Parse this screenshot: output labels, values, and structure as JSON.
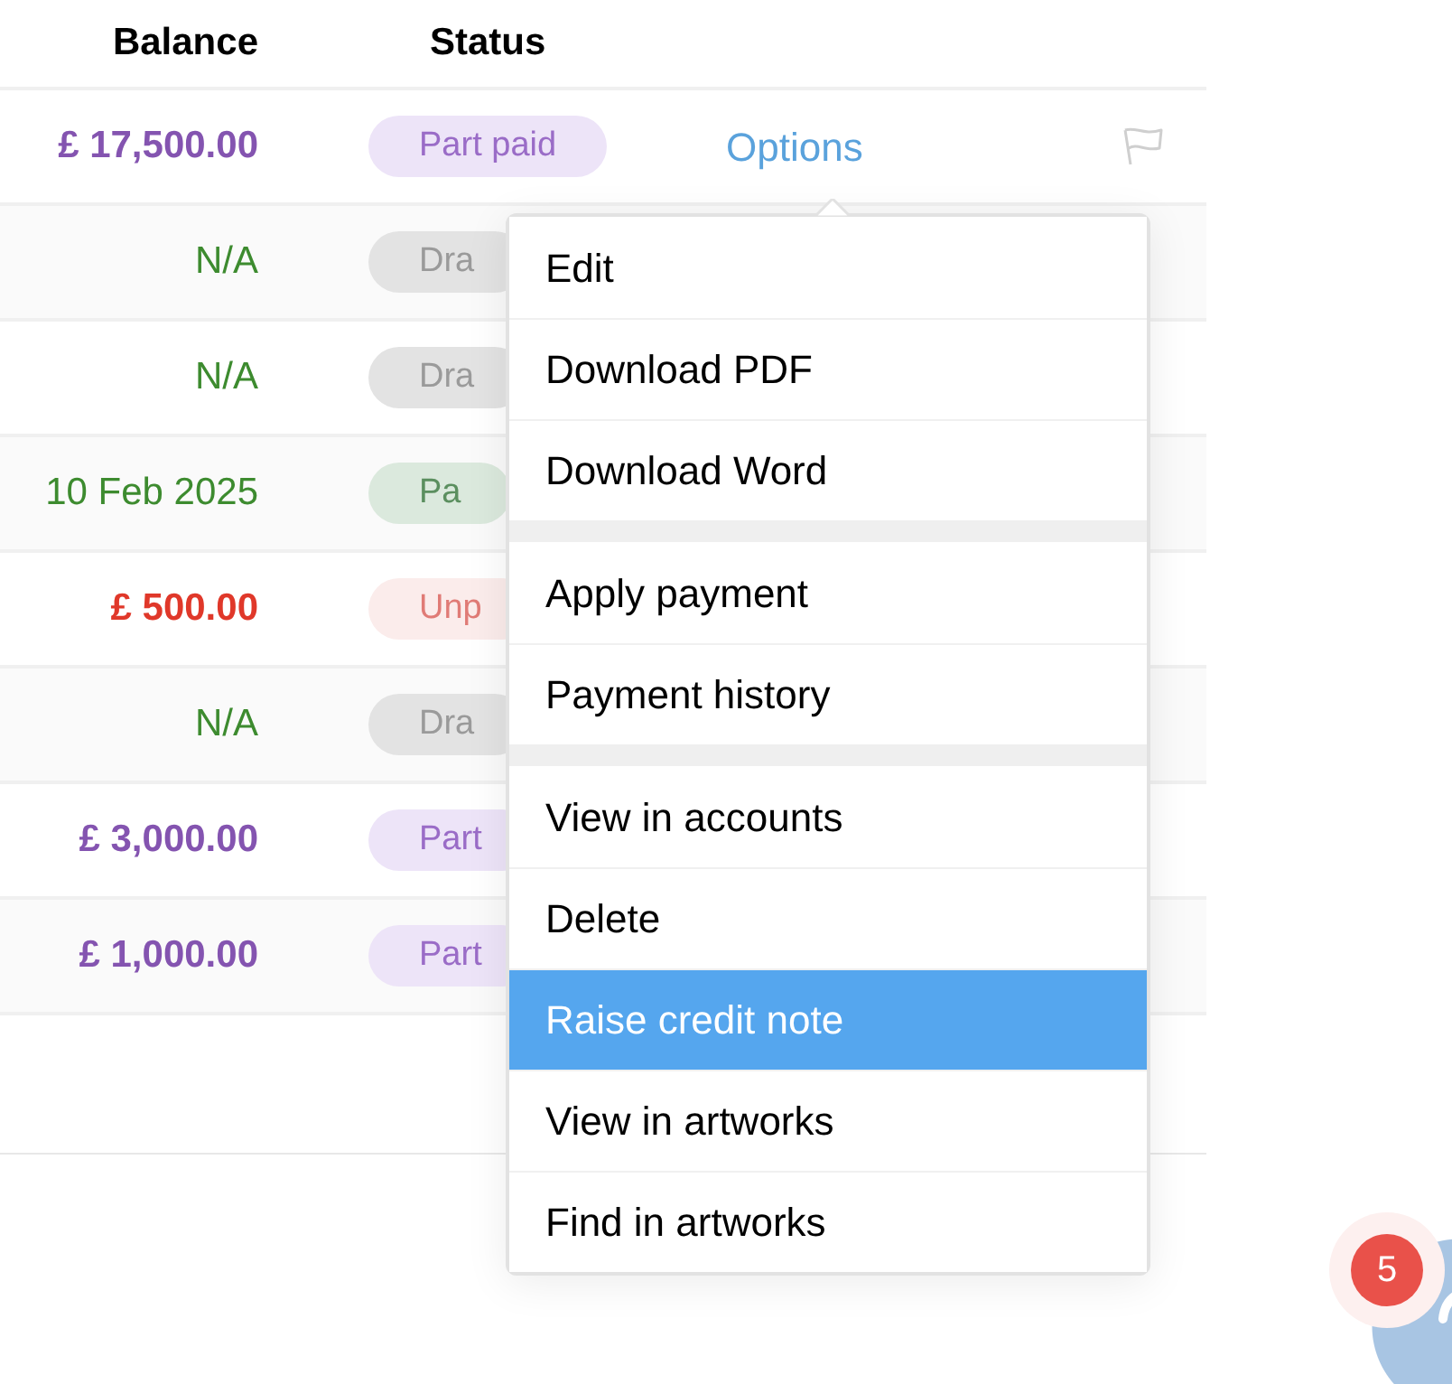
{
  "table": {
    "columns": [
      "Balance",
      "Status"
    ],
    "rows": [
      {
        "balance": "£ 17,500.00",
        "status": "Part paid",
        "kind": "part_paid",
        "options": "Options"
      },
      {
        "balance": "N/A",
        "status": "Dra",
        "kind": "draft"
      },
      {
        "balance": "N/A",
        "status": "Dra",
        "kind": "draft"
      },
      {
        "balance": "10 Feb 2025",
        "status": "Pa",
        "kind": "paid"
      },
      {
        "balance": "£ 500.00",
        "status": "Unp",
        "kind": "unpaid"
      },
      {
        "balance": "N/A",
        "status": "Dra",
        "kind": "draft"
      },
      {
        "balance": "£ 3,000.00",
        "status": "Part",
        "kind": "part_paid"
      },
      {
        "balance": "£ 1,000.00",
        "status": "Part",
        "kind": "part_paid"
      }
    ]
  },
  "options_menu": {
    "groups": [
      [
        {
          "label": "Edit",
          "selected": false
        },
        {
          "label": "Download PDF",
          "selected": false
        },
        {
          "label": "Download Word",
          "selected": false
        }
      ],
      [
        {
          "label": "Apply payment",
          "selected": false
        },
        {
          "label": "Payment history",
          "selected": false
        }
      ],
      [
        {
          "label": "View in accounts",
          "selected": false
        },
        {
          "label": "Delete",
          "selected": false
        },
        {
          "label": "Raise credit note",
          "selected": true
        },
        {
          "label": "View in artworks",
          "selected": false
        },
        {
          "label": "Find in artworks",
          "selected": false
        }
      ]
    ]
  },
  "chat_badge": "5"
}
